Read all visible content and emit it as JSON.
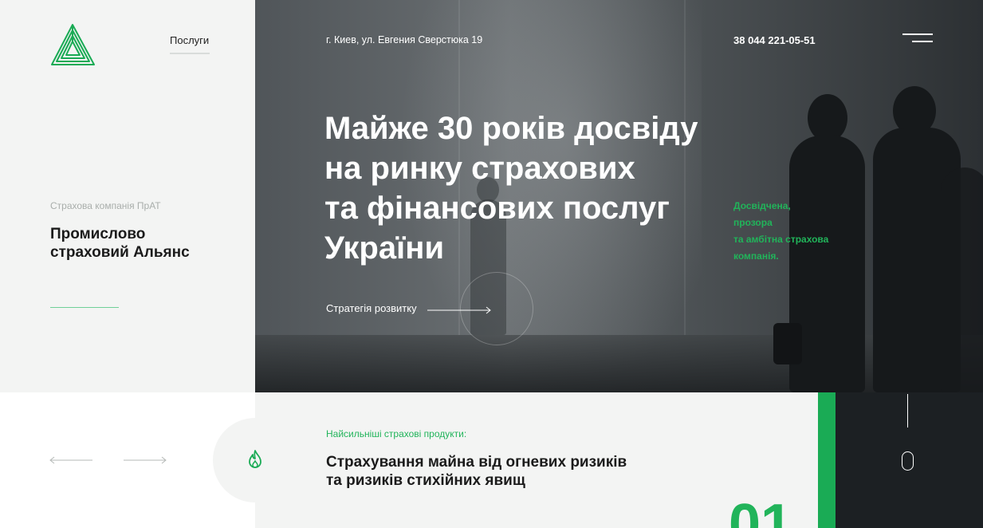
{
  "header": {
    "nav_services": "Послуги",
    "address": "г. Киев, ул. Евгения Сверстюка 19",
    "phone": "38 044 221-05-51"
  },
  "sidebar": {
    "company_subtitle": "Страхова компанія ПрАТ",
    "company_name_line1": "Промислово",
    "company_name_line2": "страховий Альянс"
  },
  "hero": {
    "headline_line1": "Майже 30 років досвіду",
    "headline_line2": "на ринку страхових",
    "headline_line3": "та фінансових послуг",
    "headline_line4": "України",
    "tagline_line1": "Досвідчена,",
    "tagline_line2": "прозора",
    "tagline_line3": "та амбітна страхова",
    "tagline_line4": "компанія.",
    "strategy_link": "Стратегія розвитку"
  },
  "product": {
    "label": "Найсильніші страхові продукти:",
    "title_line1": "Страхування майна від огневих ризиків",
    "title_line2": "та ризиків стихійних явищ",
    "number": "01"
  },
  "colors": {
    "accent_green": "#21b45a",
    "bar_green": "#1aab55",
    "dark": "#1c2023",
    "light_bg": "#f3f4f3"
  },
  "icons": {
    "logo": "triangle-logo-icon",
    "menu": "hamburger-menu-icon",
    "fire": "fire-icon",
    "scroll": "mouse-scroll-icon",
    "prev": "arrow-left-icon",
    "next": "arrow-right-icon"
  }
}
